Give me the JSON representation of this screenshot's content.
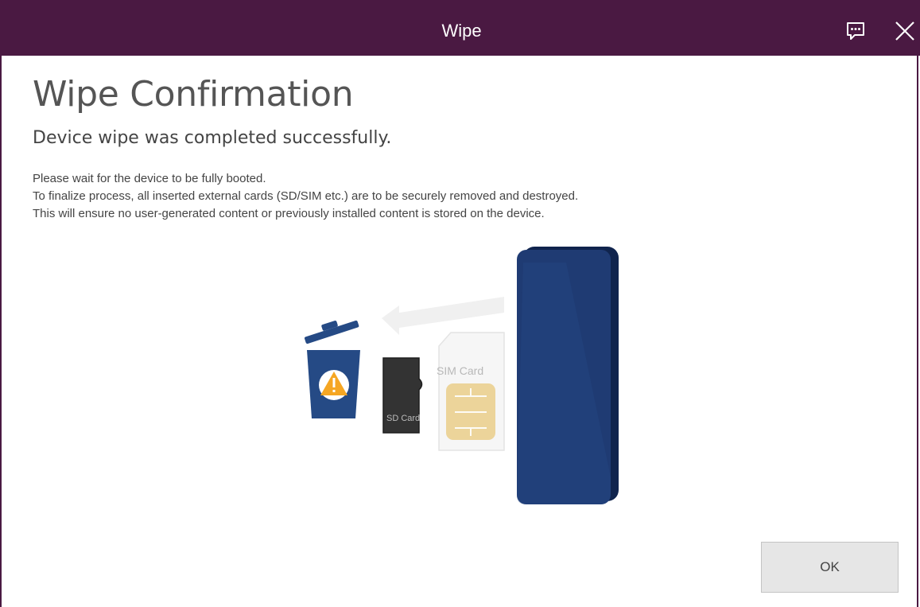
{
  "window": {
    "title": "Wipe"
  },
  "content": {
    "heading": "Wipe Confirmation",
    "subheading": "Device wipe was completed successfully.",
    "instructions": [
      "Please wait for the device to be fully booted.",
      "To finalize process, all inserted external cards (SD/SIM etc.) are to be securely removed and destroyed.",
      "This will ensure no user-generated content or previously installed content is stored on the device."
    ]
  },
  "illustration": {
    "sim_label": "SIM Card",
    "sd_label": "SD Card",
    "phone_color": "#1f3b73",
    "trash_color": "#254a85",
    "warning_color": "#f5a623"
  },
  "icons": {
    "feedback": "feedback-icon",
    "close": "close-icon",
    "trash": "trash-icon",
    "warning": "warning-icon",
    "arrow": "arrow-left-icon"
  },
  "colors": {
    "titlebar": "#4a1942"
  },
  "buttons": {
    "ok": "OK"
  }
}
